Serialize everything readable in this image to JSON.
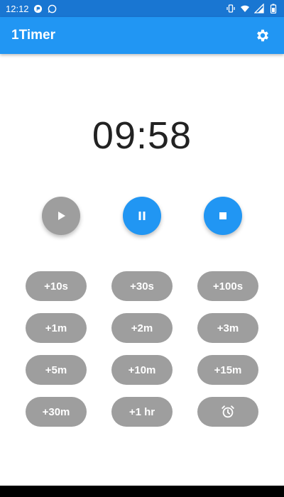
{
  "status_bar": {
    "time": "12:12"
  },
  "app_bar": {
    "title": "1Timer"
  },
  "timer": {
    "display": "09:58"
  },
  "colors": {
    "primary": "#2196f3",
    "status_bar": "#1976d2",
    "chip": "#9e9e9e",
    "disabled_control": "#9e9e9e"
  },
  "controls": {
    "play_icon": "play-icon",
    "pause_icon": "pause-icon",
    "stop_icon": "stop-icon"
  },
  "quick_add": {
    "add_10s": "+10s",
    "add_30s": "+30s",
    "add_100s": "+100s",
    "add_1m": "+1m",
    "add_2m": "+2m",
    "add_3m": "+3m",
    "add_5m": "+5m",
    "add_10m": "+10m",
    "add_15m": "+15m",
    "add_30m": "+30m",
    "add_1hr": "+1 hr",
    "alarm_icon": "alarm-clock-icon"
  }
}
